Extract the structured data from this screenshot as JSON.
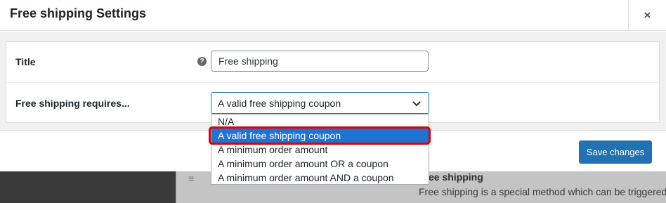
{
  "modal": {
    "title": "Free shipping Settings",
    "close_label": "×"
  },
  "form": {
    "title_label": "Title",
    "title_help_icon": "help-icon",
    "title_value": "Free shipping",
    "requires_label": "Free shipping requires...",
    "requires_selected": "A valid free shipping coupon",
    "requires_options": [
      "N/A",
      "A valid free shipping coupon",
      "A minimum order amount",
      "A minimum order amount OR a coupon",
      "A minimum order amount AND a coupon"
    ]
  },
  "footer": {
    "save_label": "Save changes"
  },
  "background": {
    "method_title": "Free shipping",
    "method_description": "Free shipping is a special method which can be triggered"
  },
  "colors": {
    "accent": "#2271b1",
    "selected_option": "#1e73d3",
    "highlight": "#e00000"
  }
}
